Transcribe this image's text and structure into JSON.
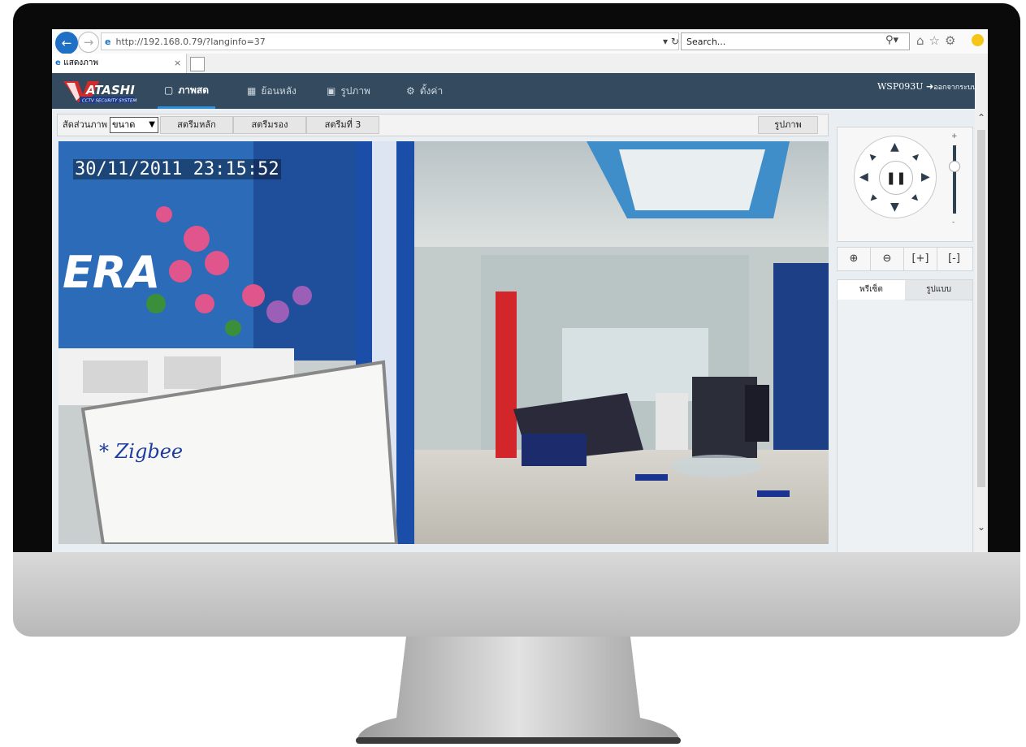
{
  "browser": {
    "url": "http://192.168.0.79/?langinfo=37",
    "search_placeholder": "Search...",
    "tab_title": "แสดงภาพ"
  },
  "header": {
    "logo_text": "ATASHI",
    "logo_subtext": "CCTV SECURITY SYSTEM",
    "nav": [
      {
        "label": "ภาพสด",
        "icon": "monitor-icon",
        "active": true
      },
      {
        "label": "ย้อนหลัง",
        "icon": "playback-icon"
      },
      {
        "label": "รูปภาพ",
        "icon": "picture-icon"
      },
      {
        "label": "ตั้งค่า",
        "icon": "gear-icon"
      }
    ],
    "device_model": "WSP093U",
    "logout_label": "ออกจากระบบ"
  },
  "toolbar": {
    "ratio_label": "สัดส่วนภาพ",
    "ratio_value": "ขนาด",
    "stream_main": "สตรีมหลัก",
    "stream_sub": "สตรีมรอง",
    "stream_3": "สตรีมที่ 3",
    "snapshot": "รูปภาพ"
  },
  "video": {
    "timestamp": "30/11/2011 23:15:52"
  },
  "ptz": {
    "speed_plus": "+",
    "speed_minus": "-",
    "speed_level": 0.7
  },
  "side_tabs": {
    "preset": "พรีเซ็ต",
    "pattern": "รูปแบบ"
  },
  "colors": {
    "header_bg": "#334a5f",
    "accent": "#2f8fd8",
    "logo_red": "#d42a2a"
  }
}
